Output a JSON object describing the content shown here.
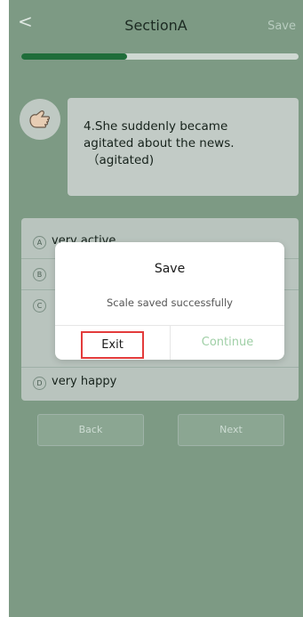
{
  "header": {
    "back_glyph": "<",
    "title": "SectionA",
    "save_label": "Save"
  },
  "progress": {
    "value": 0.38
  },
  "question": {
    "line1": "4.She suddenly became",
    "line2": "agitated about the news.",
    "line3": "（agitated)"
  },
  "options": [
    {
      "letter": "A",
      "text": "very active"
    },
    {
      "letter": "B",
      "text": ""
    },
    {
      "letter": "C",
      "text": ""
    },
    {
      "letter": "D",
      "text": "very happy"
    }
  ],
  "nav": {
    "back_label": "Back",
    "next_label": "Next"
  },
  "dialog": {
    "title": "Save",
    "message": "Scale saved successfully",
    "exit_label": "Exit",
    "continue_label": "Continue"
  }
}
